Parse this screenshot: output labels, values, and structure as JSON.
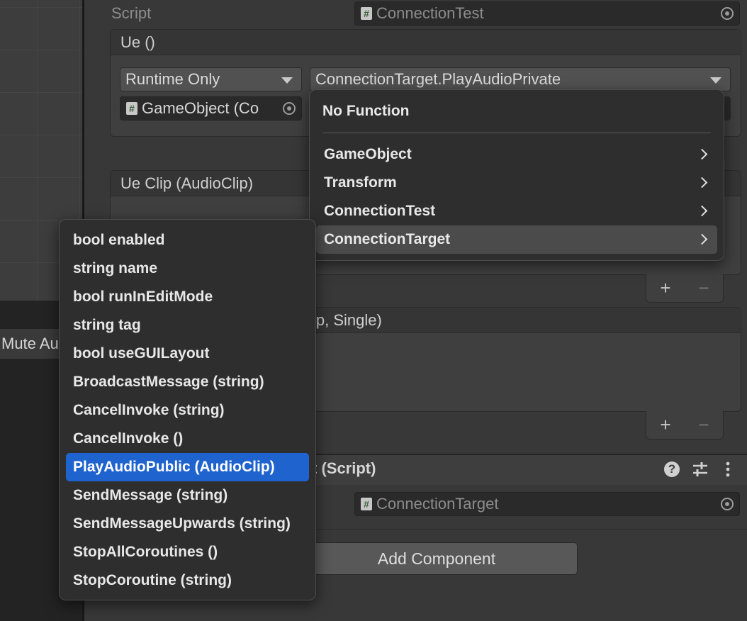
{
  "scene": {
    "mute_label": "Mute Au"
  },
  "inspector": {
    "script_label": "Script",
    "script_value": "ConnectionTest",
    "event_ue": {
      "header": "Ue ()",
      "runtime_dropdown": "Runtime Only",
      "function_dropdown": "ConnectionTarget.PlayAudioPrivate",
      "object_field": "GameObject (Co"
    },
    "event_ue_clip": {
      "header": "Ue Clip (AudioClip)"
    },
    "event_third": {
      "header_partial": "ip, Single)"
    },
    "plus_label": "+",
    "minus_label": "−",
    "component_header_partial": "t (Script)",
    "component_script_value": "ConnectionTarget",
    "add_component_label": "Add Component",
    "header_icons": [
      "help-icon",
      "preset-sliders-icon",
      "kebab-menu-icon"
    ]
  },
  "function_menu": {
    "no_function": "No Function",
    "items": [
      {
        "label": "GameObject",
        "submenu": true
      },
      {
        "label": "Transform",
        "submenu": true
      },
      {
        "label": "ConnectionTest",
        "submenu": true
      },
      {
        "label": "ConnectionTarget",
        "submenu": true,
        "highlighted": true
      }
    ]
  },
  "submenu": {
    "items": [
      "bool enabled",
      "string name",
      "bool runInEditMode",
      "string tag",
      "bool useGUILayout",
      "BroadcastMessage (string)",
      "CancelInvoke (string)",
      "CancelInvoke ()",
      "PlayAudioPublic (AudioClip)",
      "SendMessage (string)",
      "SendMessageUpwards (string)",
      "StopAllCoroutines ()",
      "StopCoroutine (string)"
    ],
    "selected": "PlayAudioPublic (AudioClip)"
  },
  "colors": {
    "selection": "#1f63cf",
    "panel": "#383838",
    "popup": "#2e2e2e"
  }
}
